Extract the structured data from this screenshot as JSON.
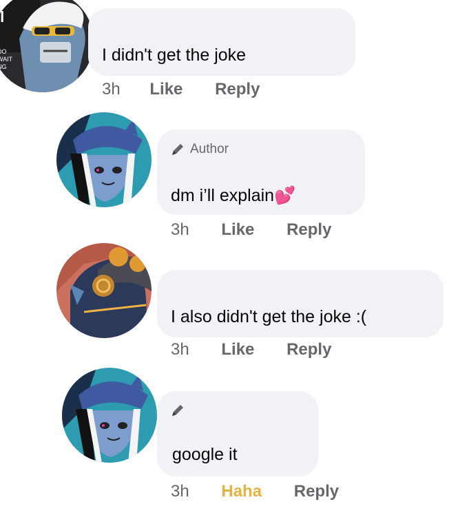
{
  "comments": [
    {
      "text": "I didn't get the joke",
      "time": "3h",
      "like_label": "Like",
      "reply_label": "Reply",
      "avatar_icon": "profile-avatar-icon"
    },
    {
      "author_label": "Author",
      "text": "dm i’ll explain💕",
      "time": "3h",
      "like_label": "Like",
      "reply_label": "Reply",
      "badge_icon": "pencil-icon"
    },
    {
      "text": "I also didn't get the joke :(",
      "time": "3h",
      "like_label": "Like",
      "reply_label": "Reply"
    },
    {
      "text": "google it",
      "time": "3h",
      "reaction_label": "Haha",
      "reply_label": "Reply",
      "badge_icon": "pencil-icon"
    }
  ],
  "colors": {
    "bubble": "#f0f2f5",
    "meta_text": "#65676b",
    "haha": "#e2b33f"
  }
}
